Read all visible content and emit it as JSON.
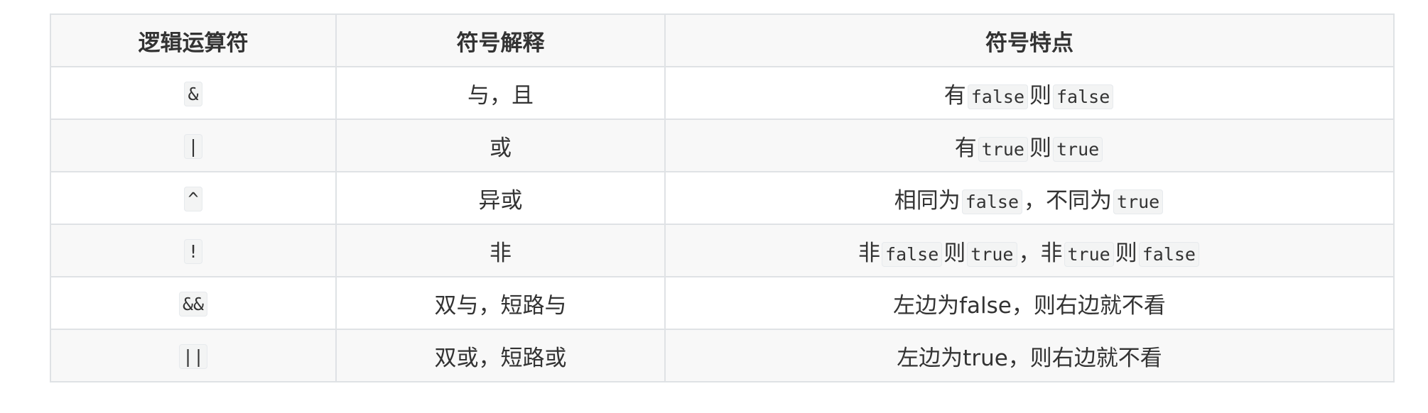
{
  "table": {
    "headers": [
      "逻辑运算符",
      "符号解释",
      "符号特点"
    ],
    "rows": [
      {
        "operator": "&",
        "meaning": "与，且",
        "feature": [
          {
            "t": "text",
            "v": "有"
          },
          {
            "t": "code",
            "v": "false"
          },
          {
            "t": "text",
            "v": "则"
          },
          {
            "t": "code",
            "v": "false"
          }
        ]
      },
      {
        "operator": "|",
        "meaning": "或",
        "feature": [
          {
            "t": "text",
            "v": "有"
          },
          {
            "t": "code",
            "v": "true"
          },
          {
            "t": "text",
            "v": "则"
          },
          {
            "t": "code",
            "v": "true"
          }
        ]
      },
      {
        "operator": "^",
        "meaning": "异或",
        "feature": [
          {
            "t": "text",
            "v": "相同为"
          },
          {
            "t": "code",
            "v": "false"
          },
          {
            "t": "text",
            "v": "，不同为"
          },
          {
            "t": "code",
            "v": "true"
          }
        ]
      },
      {
        "operator": "!",
        "meaning": "非",
        "feature": [
          {
            "t": "text",
            "v": "非"
          },
          {
            "t": "code",
            "v": "false"
          },
          {
            "t": "text",
            "v": "则"
          },
          {
            "t": "code",
            "v": "true"
          },
          {
            "t": "text",
            "v": "，非"
          },
          {
            "t": "code",
            "v": "true"
          },
          {
            "t": "text",
            "v": "则"
          },
          {
            "t": "code",
            "v": "false"
          }
        ]
      },
      {
        "operator": "&&",
        "meaning": "双与，短路与",
        "feature": [
          {
            "t": "text",
            "v": "左边为false，则右边就不看"
          }
        ]
      },
      {
        "operator": "||",
        "meaning": "双或，短路或",
        "feature": [
          {
            "t": "text",
            "v": "左边为true，则右边就不看"
          }
        ]
      }
    ]
  }
}
